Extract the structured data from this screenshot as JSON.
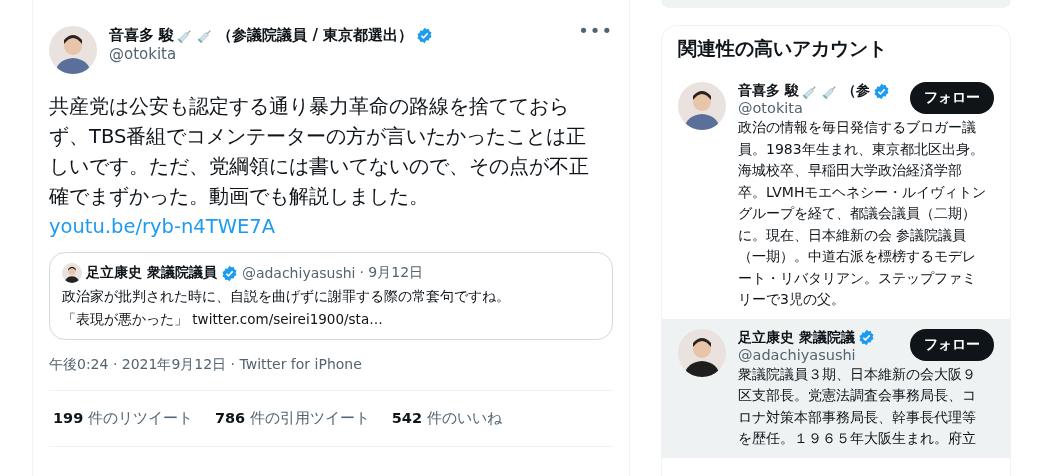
{
  "tweet": {
    "author": {
      "name": "音喜多 駿",
      "syringe_emoji": true,
      "name_suffix": "（参議院議員 / 東京都選出）",
      "verified": true,
      "handle": "@otokita",
      "more": "•••"
    },
    "text": "共産党は公安も認定する通り暴力革命の路線を捨てておらず、TBS番組でコメンテーターの方が言いたかったことは正しいです。ただ、党綱領には書いてないので、その点が不正確でまずかった。動画でも解説しました。",
    "link": "youtu.be/ryb-n4TWE7A",
    "quote": {
      "name": "足立康史 衆議院議員",
      "verified": true,
      "handle": "@adachiyasushi",
      "date": "· 9月12日",
      "text": "政治家が批判された時に、自説を曲げずに謝罪する際の常套句ですね。",
      "text_2": "「表現が悪かった」 twitter.com/seirei1900/sta…"
    },
    "meta": "午後0:24 · 2021年9月12日 · Twitter for iPhone",
    "stats": [
      {
        "count": "199",
        "label": "件のリツイート"
      },
      {
        "count": "786",
        "label": "件の引用ツイート"
      },
      {
        "count": "542",
        "label": "件のいいね"
      }
    ]
  },
  "sidebar": {
    "title": "関連性の高いアカウント",
    "accounts": [
      {
        "name": "音喜多 駿",
        "syringe_emoji": true,
        "name_suffix": "（参",
        "verified": true,
        "handle": "@otokita",
        "follow": "フォロー",
        "hovered": false,
        "bio": "政治の情報を毎日発信するブロガー議員。1983年生まれ、東京都北区出身。海城校卒、早稲田大学政治経済学部卒。LVMHモエヘネシー・ルイヴィトングループを経て、都議会議員（二期）に。現在、日本維新の会 参議院議員（一期）。中道右派を標榜するモデレート・リバタリアン。ステップファミリーで3児の父。"
      },
      {
        "name": "足立康史 衆議院議",
        "syringe_emoji": false,
        "verified": true,
        "handle": "@adachiyasushi",
        "follow": "フォロー",
        "hovered": true,
        "bio": "衆議院議員３期、日本維新の会大阪９区支部長。党憲法調査会事務局長、コロナ対策本部事務局長、幹事長代理等を歴任。１９６５年大阪生まれ。府立"
      }
    ]
  }
}
